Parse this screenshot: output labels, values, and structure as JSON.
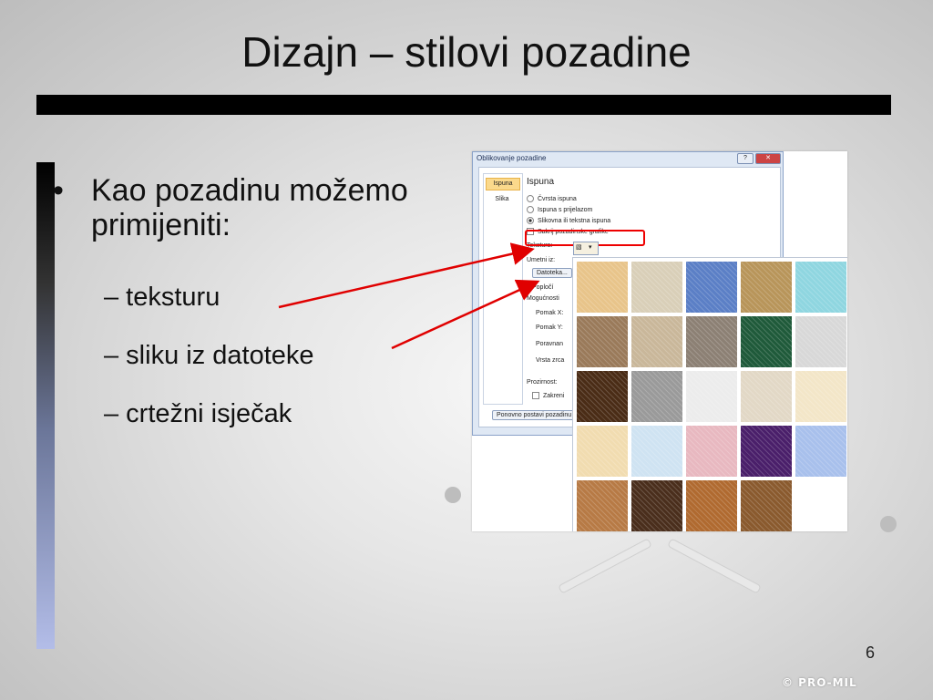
{
  "slide": {
    "title": "Dizajn – stilovi pozadine",
    "bullet_marker": "•",
    "bullet_main": "Kao pozadinu možemo primijeniti:",
    "sub_bullets": [
      "– teksturu",
      "– sliku iz datoteke",
      "– crtežni isječak"
    ],
    "page_number": "6",
    "watermark": "© PRO-MIL"
  },
  "dialog": {
    "title": "Oblikovanje pozadine",
    "help_button": "?",
    "close_button": "✕",
    "nav_items": [
      "Ispuna",
      "Slika"
    ],
    "section_title": "Ispuna",
    "options": [
      "Čvrsta ispuna",
      "Ispuna s prijelazom",
      "Slikovna ili tekstna ispuna",
      "Sakrij pozadinske grafike"
    ],
    "texture_label": "Tekstura:",
    "insert_from_label": "Umetni iz:",
    "file_button": "Datoteka...",
    "tile_option": "Popločí",
    "offsets_label": "Mogućnosti",
    "offset_x": "Pomak X:",
    "offset_y": "Pomak Y:",
    "alignment": "Poravnan",
    "mirror": "Vrsta zrca",
    "transparency": "Prozirnost:",
    "rotate": "Zakreni",
    "reset_button": "Ponovno postavi pozadinu"
  },
  "colors": {
    "title_bar": "#000000",
    "highlight": "#e00000",
    "arrow": "#e00000"
  },
  "textures": [
    "#e8c48a",
    "#d9cfb8",
    "#5b7fc6",
    "#b8955a",
    "#8fd6e0",
    "#9a7a5a",
    "#c9b79a",
    "#8c8074",
    "#1f5a3a",
    "#d8d8d8",
    "#4a2c16",
    "#9a9a9a",
    "#ececec",
    "#e2d8c6",
    "#f3e6c8",
    "#f1dcb0",
    "#cfe3f2",
    "#e8b8c0",
    "#4a1f6a",
    "#a8c0ec",
    "#b77a45",
    "#4a2e1c",
    "#b06a30",
    "#8a5a2e"
  ]
}
